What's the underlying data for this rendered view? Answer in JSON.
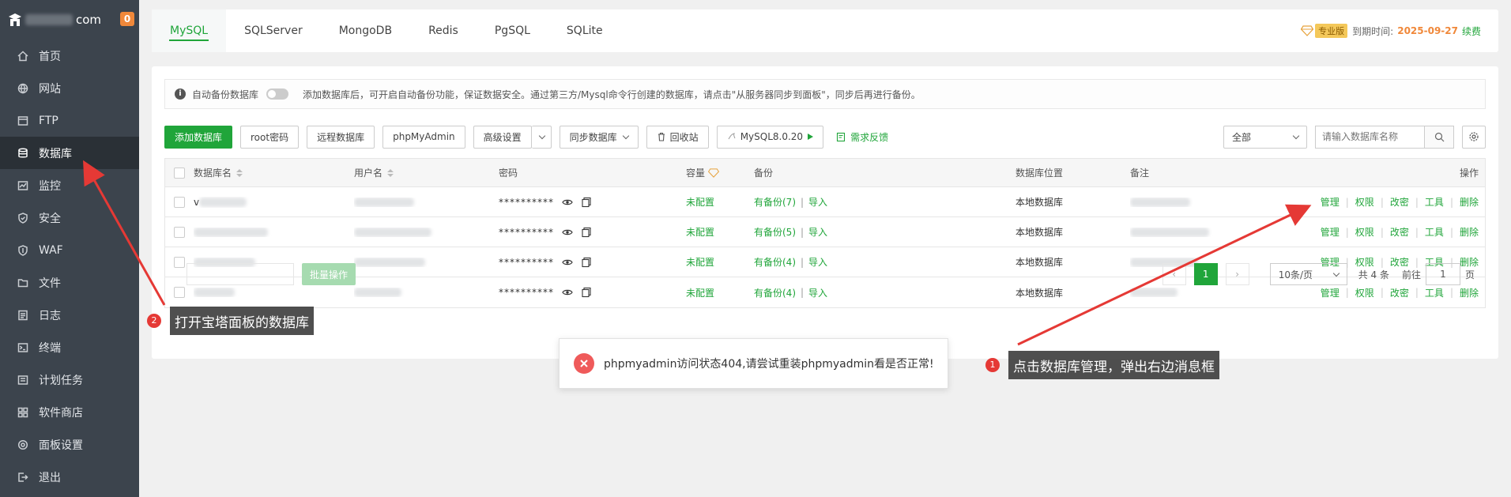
{
  "brand": {
    "suffix": "com",
    "badge": "0"
  },
  "sidebar": {
    "items": [
      {
        "label": "首页",
        "icon": "home-icon"
      },
      {
        "label": "网站",
        "icon": "globe-icon"
      },
      {
        "label": "FTP",
        "icon": "ftp-icon"
      },
      {
        "label": "数据库",
        "icon": "database-icon",
        "active": true
      },
      {
        "label": "监控",
        "icon": "monitor-icon"
      },
      {
        "label": "安全",
        "icon": "shield-icon"
      },
      {
        "label": "WAF",
        "icon": "waf-shield-icon"
      },
      {
        "label": "文件",
        "icon": "folder-icon"
      },
      {
        "label": "日志",
        "icon": "log-icon"
      },
      {
        "label": "终端",
        "icon": "terminal-icon"
      },
      {
        "label": "计划任务",
        "icon": "clock-icon"
      },
      {
        "label": "软件商店",
        "icon": "store-icon"
      },
      {
        "label": "面板设置",
        "icon": "gear-icon"
      },
      {
        "label": "退出",
        "icon": "logout-icon"
      }
    ]
  },
  "tabs": [
    "MySQL",
    "SQLServer",
    "MongoDB",
    "Redis",
    "PgSQL",
    "SQLite"
  ],
  "expire": {
    "badge": "专业版",
    "label": "到期时间:",
    "date": "2025-09-27",
    "renew": "续费"
  },
  "notice": {
    "toggle_label": "自动备份数据库",
    "text": "添加数据库后，可开启自动备份功能，保证数据安全。通过第三方/Mysql命令行创建的数据库，请点击\"从服务器同步到面板\"，同步后再进行备份。"
  },
  "toolbar": {
    "add": "添加数据库",
    "root_pwd": "root密码",
    "remote": "远程数据库",
    "phpmyadmin": "phpMyAdmin",
    "advanced": "高级设置",
    "sync": "同步数据库",
    "recycle": "回收站",
    "mysql_version": "MySQL8.0.20",
    "feedback": "需求反馈",
    "filter": "全部",
    "search_placeholder": "请输入数据库名称"
  },
  "table": {
    "headers": {
      "name": "数据库名",
      "user": "用户名",
      "password": "密码",
      "capacity": "容量",
      "backup": "备份",
      "location": "数据库位置",
      "note": "备注",
      "ops": "操作"
    },
    "rows": [
      {
        "name_visible": "v",
        "password": "**********",
        "capacity": "未配置",
        "backup": "有备份(7)",
        "import": "导入",
        "location": "本地数据库"
      },
      {
        "name_visible": "",
        "password": "**********",
        "capacity": "未配置",
        "backup": "有备份(5)",
        "import": "导入",
        "location": "本地数据库"
      },
      {
        "name_visible": "",
        "password": "**********",
        "capacity": "未配置",
        "backup": "有备份(4)",
        "import": "导入",
        "location": "本地数据库"
      },
      {
        "name_visible": "",
        "password": "**********",
        "capacity": "未配置",
        "backup": "有备份(4)",
        "import": "导入",
        "location": "本地数据库"
      }
    ],
    "ops": [
      "管理",
      "权限",
      "改密",
      "工具",
      "删除"
    ]
  },
  "footer": {
    "batch_label": "批量操作",
    "pager": {
      "current": "1",
      "page_size": "10条/页",
      "total": "共 4 条",
      "goto_label": "前往",
      "goto_value": "1",
      "page_unit": "页"
    }
  },
  "toast": {
    "message": "phpmyadmin访问状态404,请尝试重装phpmyadmin看是否正常!"
  },
  "annotations": {
    "one": {
      "num": "1",
      "text": "点击数据库管理，弹出右边消息框"
    },
    "two": {
      "num": "2",
      "text": "打开宝塔面板的数据库"
    },
    "arrow_color": "#e53935"
  }
}
